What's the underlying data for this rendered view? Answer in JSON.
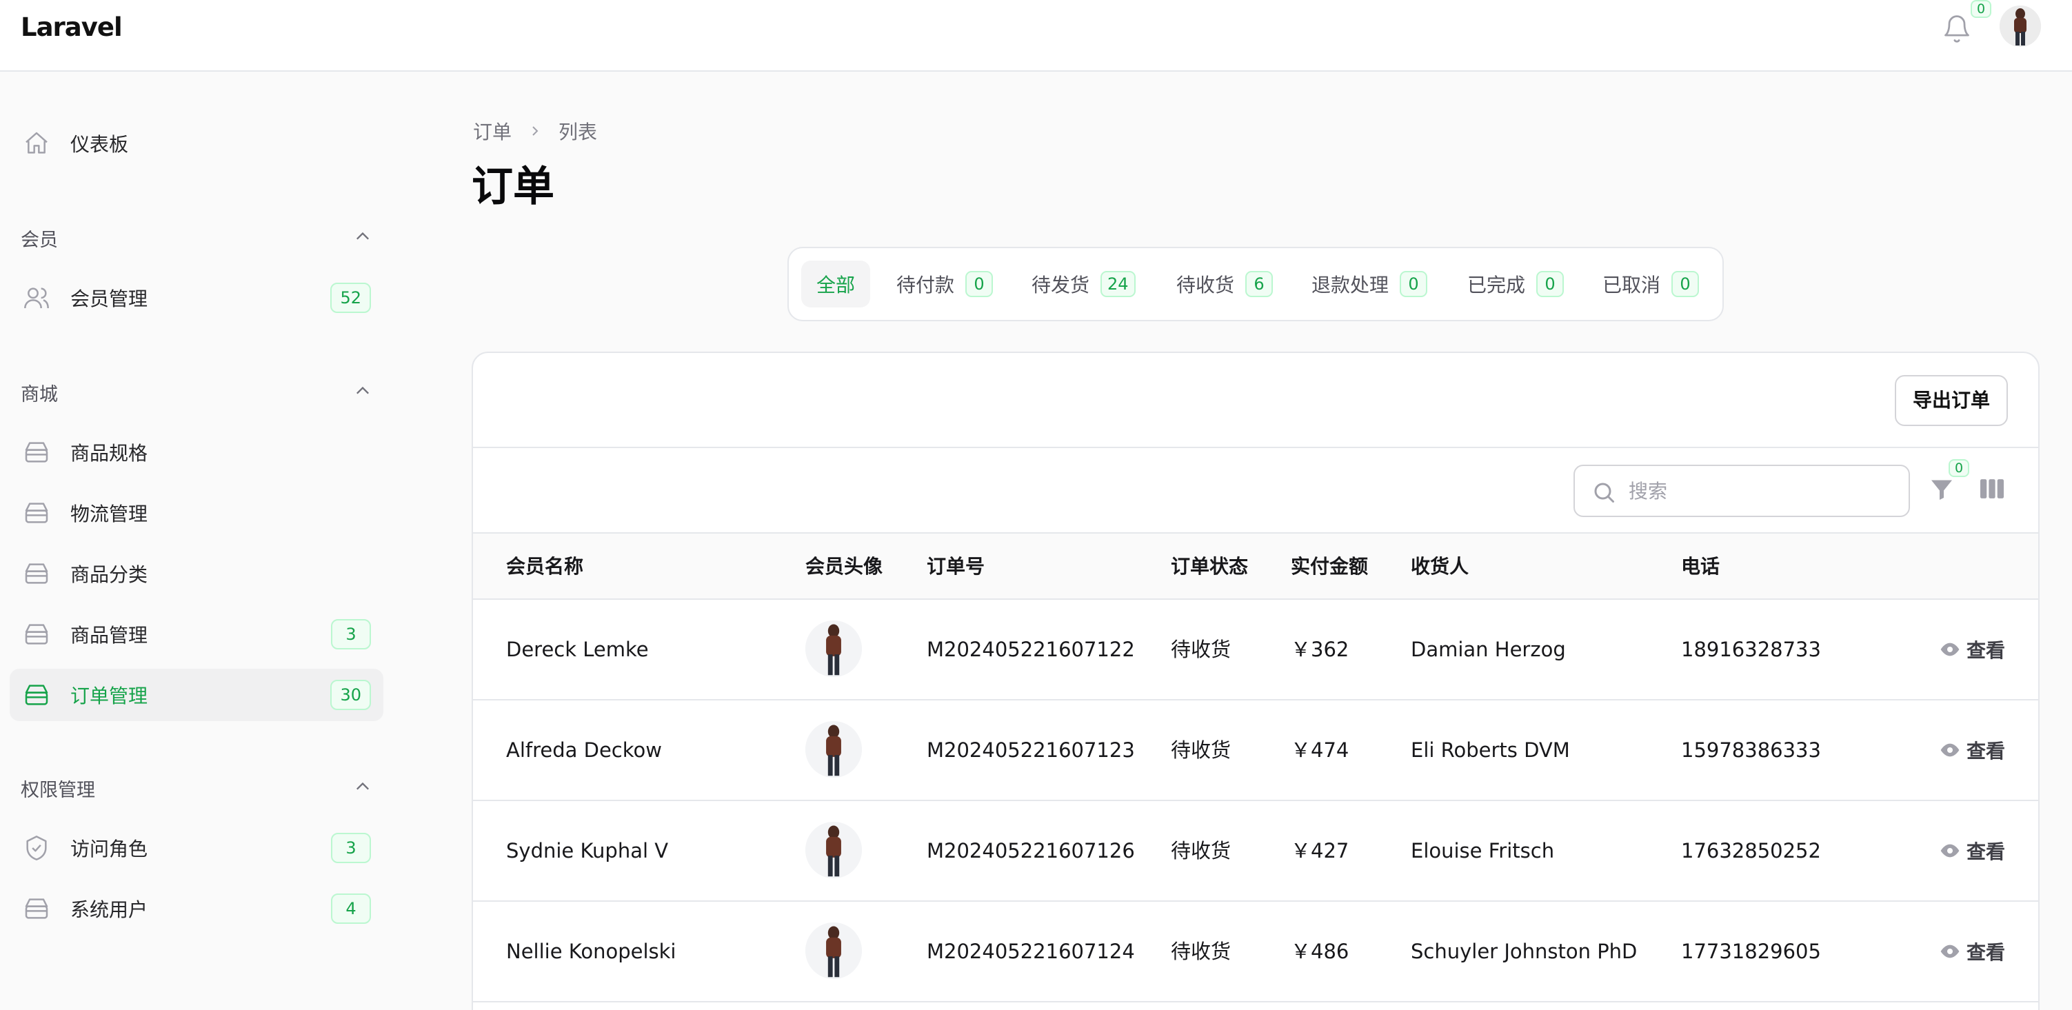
{
  "app": {
    "logo": "Laravel",
    "notifications_count": "0"
  },
  "sidebar": {
    "dashboard": {
      "label": "仪表板",
      "icon": "home-icon"
    },
    "groups": [
      {
        "label": "会员",
        "items": [
          {
            "label": "会员管理",
            "count": "52",
            "icon": "users-icon"
          }
        ]
      },
      {
        "label": "商城",
        "items": [
          {
            "label": "商品规格",
            "icon": "box-icon"
          },
          {
            "label": "物流管理",
            "icon": "box-icon"
          },
          {
            "label": "商品分类",
            "icon": "box-icon"
          },
          {
            "label": "商品管理",
            "count": "3",
            "icon": "box-icon"
          },
          {
            "label": "订单管理",
            "count": "30",
            "icon": "box-icon",
            "active": true
          }
        ]
      },
      {
        "label": "权限管理",
        "items": [
          {
            "label": "访问角色",
            "count": "3",
            "icon": "shield-check-icon"
          },
          {
            "label": "系统用户",
            "count": "4",
            "icon": "box-icon"
          }
        ]
      }
    ]
  },
  "breadcrumb": [
    "订单",
    "列表"
  ],
  "page_title": "订单",
  "tabs": [
    {
      "label": "全部",
      "active": true
    },
    {
      "label": "待付款",
      "count": "0"
    },
    {
      "label": "待发货",
      "count": "24"
    },
    {
      "label": "待收货",
      "count": "6"
    },
    {
      "label": "退款处理",
      "count": "0"
    },
    {
      "label": "已完成",
      "count": "0"
    },
    {
      "label": "已取消",
      "count": "0"
    }
  ],
  "toolbar": {
    "export_label": "导出订单",
    "search_placeholder": "搜索",
    "filter_count": "0"
  },
  "table": {
    "headers": [
      "会员名称",
      "会员头像",
      "订单号",
      "订单状态",
      "实付金额",
      "收货人",
      "电话"
    ],
    "view_label": "查看",
    "rows": [
      {
        "member": "Dereck Lemke",
        "order_no": "M202405221607122",
        "status": "待收货",
        "amount": "￥362",
        "receiver": "Damian Herzog",
        "phone": "18916328733"
      },
      {
        "member": "Alfreda Deckow",
        "order_no": "M202405221607123",
        "status": "待收货",
        "amount": "￥474",
        "receiver": "Eli Roberts DVM",
        "phone": "15978386333"
      },
      {
        "member": "Sydnie Kuphal V",
        "order_no": "M202405221607126",
        "status": "待收货",
        "amount": "￥427",
        "receiver": "Elouise Fritsch",
        "phone": "17632850252"
      },
      {
        "member": "Nellie Konopelski",
        "order_no": "M202405221607124",
        "status": "待收货",
        "amount": "￥486",
        "receiver": "Schuyler Johnston PhD",
        "phone": "17731829605"
      }
    ]
  },
  "colors": {
    "accent": "#16a34a",
    "badge_bg": "#f0fdf4",
    "badge_border": "#bbf7d0",
    "border": "#e5e7eb"
  }
}
